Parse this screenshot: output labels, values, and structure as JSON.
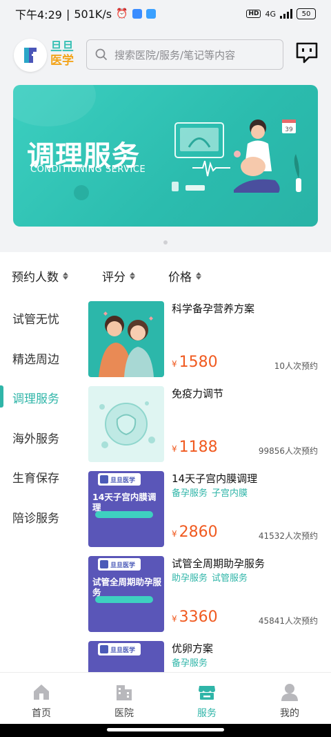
{
  "status_bar": {
    "time": "下午4:29",
    "separator": "|",
    "speed": "501K/s",
    "hd": "HD",
    "network": "4G",
    "battery": "50"
  },
  "header": {
    "logo_line1": "旦旦",
    "logo_line2": "医学",
    "search_placeholder": "搜索医院/服务/笔记等内容",
    "icons": [
      "search-icon",
      "message-icon"
    ]
  },
  "banner": {
    "title": "调理服务",
    "subtitle": "CONDITIONING SERVICE",
    "calendar_number": "39",
    "accent_color": "#2bbcae"
  },
  "sort_bar": {
    "items": [
      {
        "label": "预约人数"
      },
      {
        "label": "评分"
      },
      {
        "label": "价格"
      }
    ]
  },
  "categories": [
    {
      "label": "试管无忧",
      "active": false
    },
    {
      "label": "精选周边",
      "active": false
    },
    {
      "label": "调理服务",
      "active": true
    },
    {
      "label": "海外服务",
      "active": false
    },
    {
      "label": "生育保存",
      "active": false
    },
    {
      "label": "陪诊服务",
      "active": false
    }
  ],
  "products": [
    {
      "name": "科学备孕营养方案",
      "tags": [],
      "currency": "¥",
      "price": "1580",
      "count": "10人次预约"
    },
    {
      "name": "免疫力调节",
      "tags": [],
      "currency": "¥",
      "price": "1188",
      "count": "99856人次预约"
    },
    {
      "name": "14天子宫内膜调理",
      "tags": [
        "备孕服务",
        "子宫内膜"
      ],
      "currency": "¥",
      "price": "2860",
      "count": "41532人次预约",
      "thumb_title": "14天子宫内膜调理",
      "thumb_brand": "旦旦医学"
    },
    {
      "name": "试管全周期助孕服务",
      "tags": [
        "助孕服务",
        "试管服务"
      ],
      "currency": "¥",
      "price": "3360",
      "count": "45841人次预约",
      "thumb_title": "试管全周期助孕服务",
      "thumb_brand": "旦旦医学"
    },
    {
      "name": "优卵方案",
      "tags": [
        "备孕服务"
      ],
      "thumb_brand": "旦旦医学"
    }
  ],
  "bottom_nav": {
    "tabs": [
      {
        "label": "首页",
        "icon": "home-icon",
        "active": false
      },
      {
        "label": "医院",
        "icon": "hospital-icon",
        "active": false
      },
      {
        "label": "服务",
        "icon": "service-store-icon",
        "active": true
      },
      {
        "label": "我的",
        "icon": "profile-icon",
        "active": false
      }
    ]
  }
}
